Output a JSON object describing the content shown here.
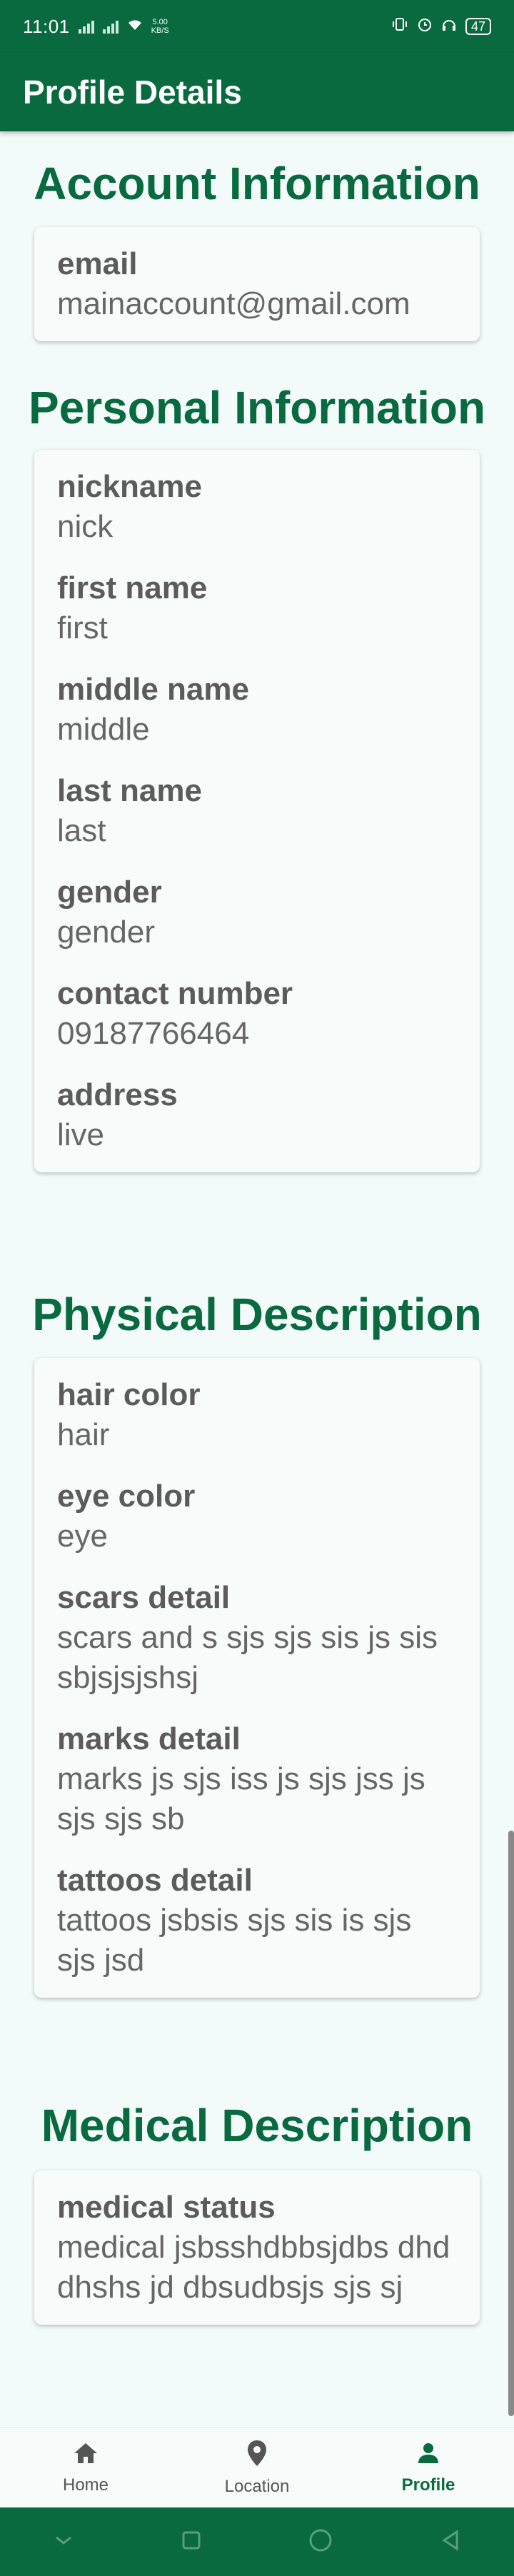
{
  "status_bar": {
    "time": "11:01",
    "net_speed": "5.00",
    "net_unit": "KB/S",
    "battery": "47"
  },
  "app_bar": {
    "title": "Profile Details"
  },
  "sections": {
    "account": {
      "title": "Account Information",
      "fields": [
        {
          "label": "email",
          "value": "mainaccount@gmail.com"
        }
      ]
    },
    "personal": {
      "title": "Personal Information",
      "fields": [
        {
          "label": "nickname",
          "value": "nick"
        },
        {
          "label": "first name",
          "value": "first"
        },
        {
          "label": "middle name",
          "value": "middle"
        },
        {
          "label": "last name",
          "value": "last"
        },
        {
          "label": "gender",
          "value": "gender"
        },
        {
          "label": "contact number",
          "value": "09187766464"
        },
        {
          "label": "address",
          "value": "live"
        }
      ]
    },
    "physical": {
      "title": "Physical Description",
      "fields": [
        {
          "label": "hair color",
          "value": "hair"
        },
        {
          "label": "eye color",
          "value": "eye"
        },
        {
          "label": "scars detail",
          "value": "scars and s sjs sjs sis js sis sbjsjsjshsj"
        },
        {
          "label": "marks detail",
          "value": "marks js sjs iss js sjs jss js sjs sjs sb"
        },
        {
          "label": "tattoos detail",
          "value": "tattoos jsbsis sjs sis is sjs sjs jsd"
        }
      ]
    },
    "medical": {
      "title": "Medical Description",
      "fields": [
        {
          "label": "medical status",
          "value": "medical jsbsshdbbsjdbs dhd dhshs jd dbsudbsjs sjs sj"
        }
      ]
    }
  },
  "bottom_nav": {
    "items": [
      {
        "label": "Home",
        "icon": "home-icon"
      },
      {
        "label": "Location",
        "icon": "location-pin-icon"
      },
      {
        "label": "Profile",
        "icon": "person-icon",
        "active": true
      }
    ]
  },
  "colors": {
    "primary": "#086a3e",
    "background": "#f3fbfa"
  }
}
